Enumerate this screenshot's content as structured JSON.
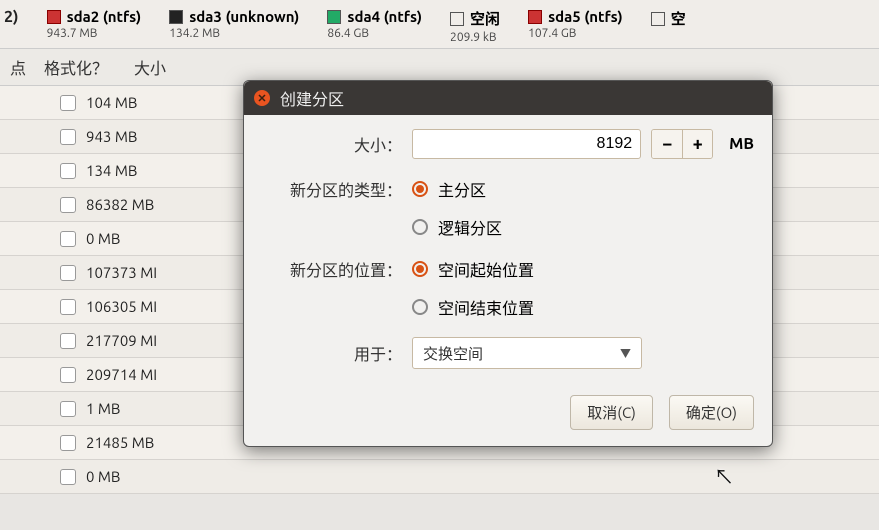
{
  "legend": {
    "trunc_left": "2)",
    "items": [
      {
        "label": "sda2 (ntfs)",
        "sub": "943.7 MB",
        "swatch": "sw-red"
      },
      {
        "label": "sda3 (unknown)",
        "sub": "134.2 MB",
        "swatch": "sw-black"
      },
      {
        "label": "sda4 (ntfs)",
        "sub": "86.4 GB",
        "swatch": "sw-green"
      },
      {
        "label": "空闲",
        "sub": "209.9 kB",
        "swatch": "sw-empty"
      },
      {
        "label": "sda5 (ntfs)",
        "sub": "107.4 GB",
        "swatch": "sw-red"
      }
    ],
    "trunc_right": "空"
  },
  "table": {
    "headers": {
      "pt": "点",
      "fmt": "格式化？",
      "size": "大小"
    },
    "rows": [
      "104 MB",
      "943 MB",
      "134 MB",
      "86382 MB",
      "0 MB",
      "107373 MI",
      "106305 MI",
      "217709 MI",
      "209714 MI",
      "1 MB",
      "21485 MB",
      "0 MB"
    ]
  },
  "dialog": {
    "title": "创建分区",
    "size_label": "大小：",
    "size_value": "8192",
    "unit": "MB",
    "type_label": "新分区的类型：",
    "type_opts": {
      "primary": "主分区",
      "logical": "逻辑分区"
    },
    "pos_label": "新分区的位置：",
    "pos_opts": {
      "begin": "空间起始位置",
      "end": "空间结束位置"
    },
    "use_label": "用于：",
    "use_value": "交换空间",
    "cancel": "取消(C)",
    "ok": "确定(O)"
  }
}
